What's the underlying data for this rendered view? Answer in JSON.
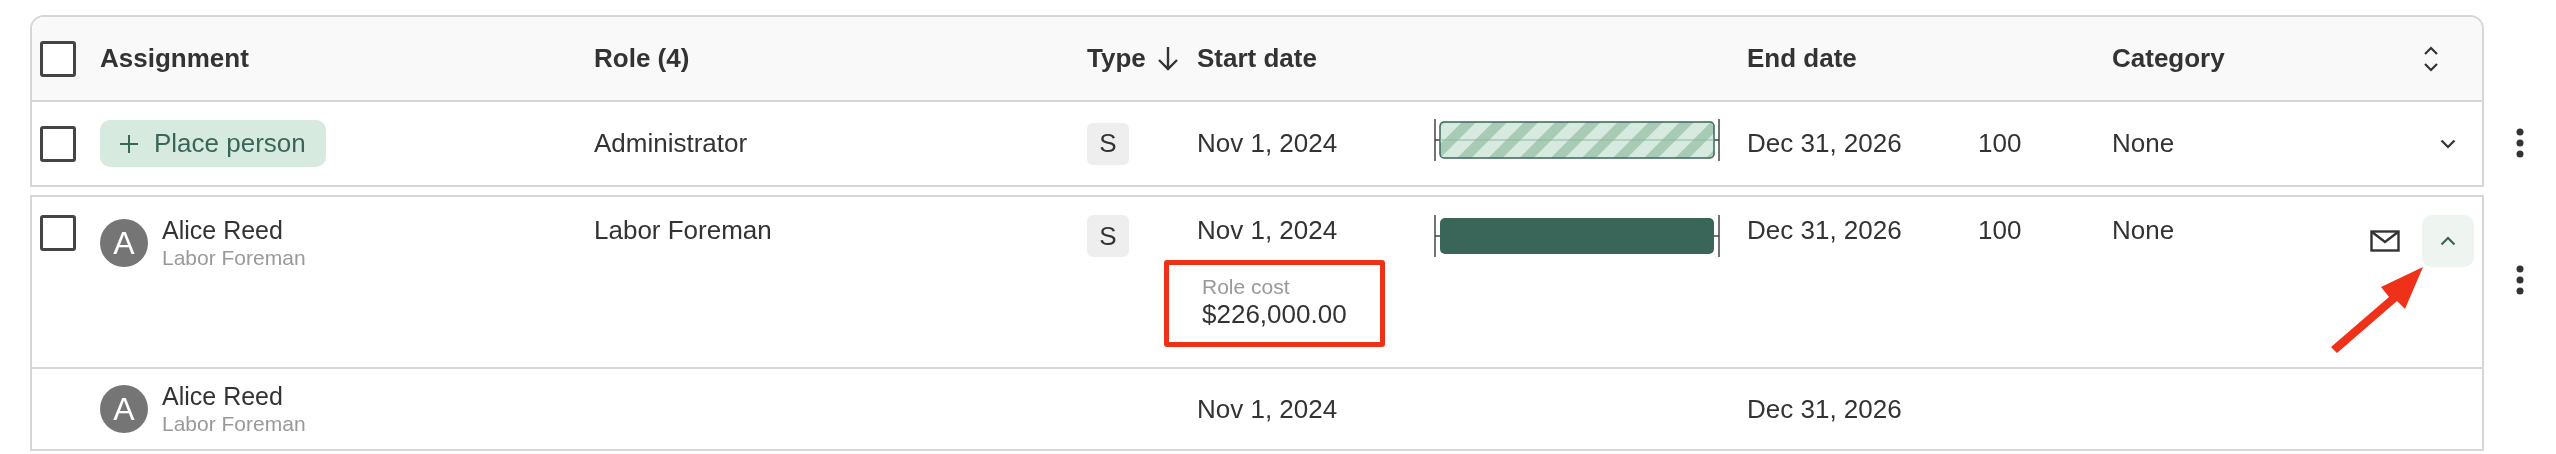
{
  "table": {
    "select_all": {
      "checked": false
    },
    "columns": [
      {
        "label": "Assignment"
      },
      {
        "label": "Role (4)"
      },
      {
        "label": "Type",
        "sorted_descending": true
      },
      {
        "label": "Start date"
      },
      {
        "label": "End date"
      },
      {
        "label": "Category"
      }
    ],
    "rows": [
      {
        "kind": "open_role",
        "checked": false,
        "place_label": "Place person",
        "role": "Administrator",
        "type": "S",
        "start": "Nov 1, 2024",
        "bar": {
          "kind": "striped"
        },
        "end": "Dec 31, 2026",
        "quantity": "100",
        "category": "None",
        "mail": false,
        "expanded": false,
        "pointer_arrow": false
      },
      {
        "kind": "assigned",
        "checked": false,
        "avatar_initial": "A",
        "name": "Alice Reed",
        "subtitle": "Labor Foreman",
        "role": "Labor Foreman",
        "type": "S",
        "start": "Nov 1, 2024",
        "bar": {
          "kind": "solid"
        },
        "end": "Dec 31, 2026",
        "quantity": "100",
        "category": "None",
        "mail": true,
        "expanded": true,
        "pointer_arrow": true,
        "details": {
          "label": "Role cost",
          "value": "$226,000.00",
          "highlighted": true
        }
      },
      {
        "kind": "assignee",
        "avatar_initial": "A",
        "name": "Alice Reed",
        "subtitle": "Labor Foreman",
        "start": "Nov 1, 2024",
        "end": "Dec 31, 2026"
      }
    ]
  }
}
